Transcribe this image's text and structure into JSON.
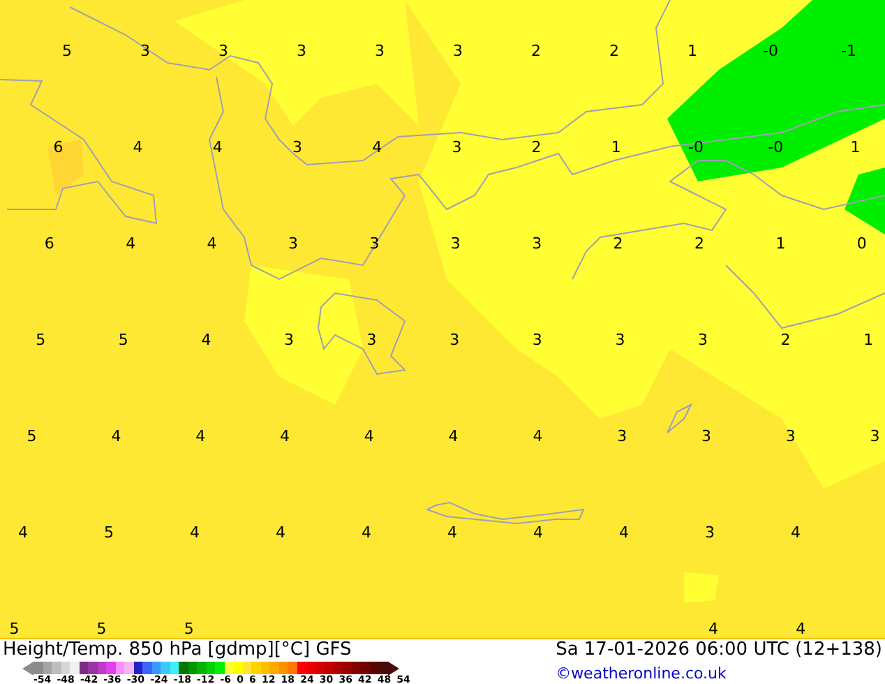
{
  "map": {
    "rows": [
      [
        "5",
        "3",
        "3",
        "3",
        "3",
        "3",
        "2",
        "2",
        "1",
        "-0",
        "-1"
      ],
      [
        "6",
        "4",
        "4",
        "3",
        "4",
        "3",
        "2",
        "1",
        "-0",
        "-0",
        "1"
      ],
      [
        "6",
        "4",
        "4",
        "3",
        "3",
        "3",
        "3",
        "2",
        "2",
        "1",
        "0"
      ],
      [
        "5",
        "5",
        "4",
        "3",
        "3",
        "3",
        "3",
        "3",
        "3",
        "2",
        "1"
      ],
      [
        "5",
        "4",
        "4",
        "4",
        "4",
        "4",
        "4",
        "3",
        "3",
        "3",
        "3"
      ],
      [
        "4",
        "5",
        "4",
        "4",
        "4",
        "4",
        "4",
        "4",
        "3",
        "4"
      ],
      [
        "5",
        "5",
        "5",
        null,
        null,
        null,
        null,
        null,
        "4",
        "4"
      ]
    ]
  },
  "footer": {
    "title": "Height/Temp. 850 hPa [gdmp][°C] GFS",
    "datetime": "Sa 17-01-2026 06:00 UTC (12+138)",
    "credit": "©weatheronline.co.uk",
    "scale": {
      "swatches": [
        {
          "color": "#8c8c8c"
        },
        {
          "color": "#a5a5a5"
        },
        {
          "color": "#bebebe"
        },
        {
          "color": "#d7d7d7"
        },
        {
          "color": "#f0f0f0"
        },
        {
          "color": "#7a2c86"
        },
        {
          "color": "#9b33a6"
        },
        {
          "color": "#bb3cc6"
        },
        {
          "color": "#e040f0"
        },
        {
          "color": "#ff8cff"
        },
        {
          "color": "#f5b4f5"
        },
        {
          "color": "#2222c8"
        },
        {
          "color": "#3c64ff"
        },
        {
          "color": "#3c96ff"
        },
        {
          "color": "#3cc8ff"
        },
        {
          "color": "#3cf0ff"
        },
        {
          "color": "#007800"
        },
        {
          "color": "#009600"
        },
        {
          "color": "#00b400"
        },
        {
          "color": "#00d200"
        },
        {
          "color": "#00f000"
        },
        {
          "color": "#ffff3c"
        },
        {
          "color": "#ffff00"
        },
        {
          "color": "#ffe632"
        },
        {
          "color": "#ffd200"
        },
        {
          "color": "#ffbe00"
        },
        {
          "color": "#ffaa00"
        },
        {
          "color": "#ff9100"
        },
        {
          "color": "#ff7800"
        },
        {
          "color": "#ff0000"
        },
        {
          "color": "#eb0000"
        },
        {
          "color": "#d70000"
        },
        {
          "color": "#c30000"
        },
        {
          "color": "#af0000"
        },
        {
          "color": "#9b0000"
        },
        {
          "color": "#870000"
        },
        {
          "color": "#730000"
        },
        {
          "color": "#5f0000"
        },
        {
          "color": "#4b0a0a"
        }
      ],
      "labels": [
        "-54",
        "-48",
        "-42",
        "-36",
        "-30",
        "-24",
        "-18",
        "-12",
        "-6",
        "0",
        "6",
        "12",
        "18",
        "24",
        "30",
        "36",
        "42",
        "48",
        "54"
      ]
    }
  }
}
